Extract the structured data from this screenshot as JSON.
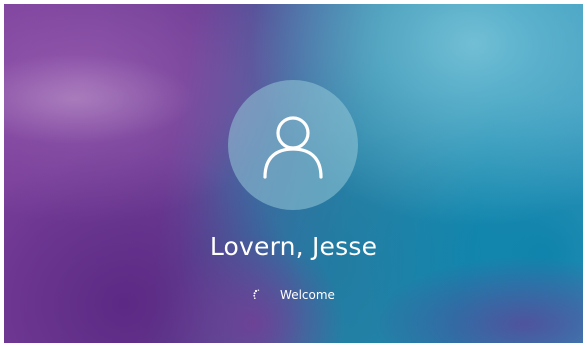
{
  "login_screen": {
    "user_name": "Lovern, Jesse",
    "status_text": "Welcome",
    "avatar_icon": "user-silhouette-icon",
    "spinner_icon": "loading-spinner-icon"
  },
  "colors": {
    "purple": "#6d3c94",
    "teal": "#1a8ab0",
    "text": "#ffffff"
  }
}
